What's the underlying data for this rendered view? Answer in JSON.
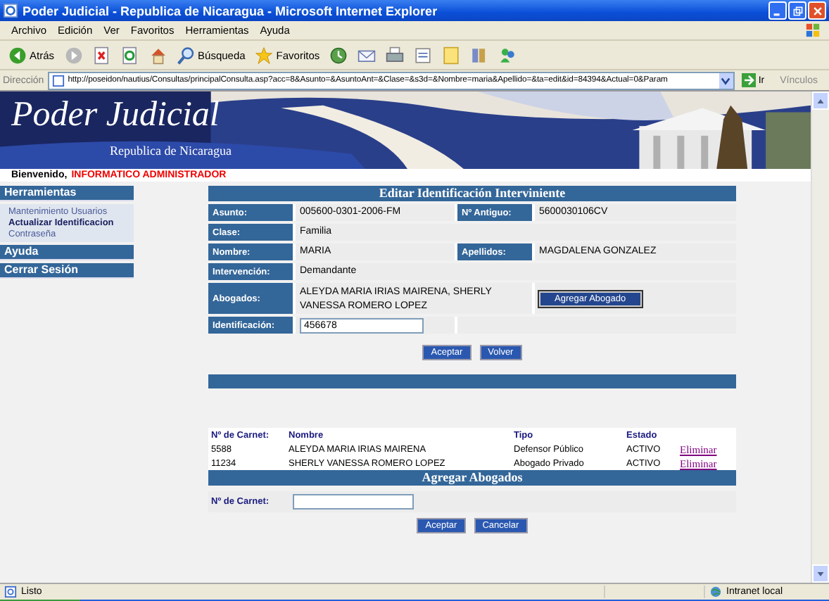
{
  "window": {
    "title": "Poder Judicial - Republica de Nicaragua - Microsoft Internet Explorer"
  },
  "menu": [
    "Archivo",
    "Edición",
    "Ver",
    "Favoritos",
    "Herramientas",
    "Ayuda"
  ],
  "toolbar": [
    {
      "kind": "back",
      "label": "Atrás"
    },
    {
      "kind": "forward"
    },
    {
      "kind": "stop"
    },
    {
      "kind": "refresh"
    },
    {
      "kind": "home"
    },
    {
      "kind": "search",
      "label": "Búsqueda"
    },
    {
      "kind": "favorites",
      "label": "Favoritos"
    },
    {
      "kind": "history"
    },
    {
      "kind": "mail"
    },
    {
      "kind": "print"
    },
    {
      "kind": "edit"
    },
    {
      "kind": "note"
    },
    {
      "kind": "research"
    },
    {
      "kind": "messenger"
    }
  ],
  "address": {
    "label": "Dirección",
    "value": "http://poseidon/nautius/Consultas/principalConsulta.asp?acc=8&Asunto=&AsuntoAnt=&Clase=&s3d=&Nombre=maria&Apellido=&ta=edit&id=84394&Actual=0&Param",
    "go": "Ir",
    "links": "Vínculos"
  },
  "banner": {
    "title": "Poder Judicial",
    "subtitle": "Republica de Nicaragua"
  },
  "welcome": {
    "label": "Bienvenido,",
    "user": "INFORMATICO ADMINISTRADOR"
  },
  "sidebar": [
    {
      "title": "Herramientas",
      "items": [
        {
          "label": "Mantenimiento Usuarios",
          "selected": false
        },
        {
          "label": "Actualizar Identificacion",
          "selected": true
        },
        {
          "label": "Contraseña",
          "selected": false
        }
      ]
    },
    {
      "title": "Ayuda"
    },
    {
      "title": "Cerrar Sesión"
    }
  ],
  "form": {
    "title": "Editar Identificación Interviniente",
    "rows": [
      {
        "label": "Asunto:",
        "value": "005600-0301-2006-FM",
        "label2": "Nº Antiguo:",
        "value2": "5600030106CV"
      },
      {
        "label": "Clase:",
        "value": "Familia"
      },
      {
        "label": "Nombre:",
        "value": "MARIA",
        "label2": "Apellidos:",
        "value2": "MAGDALENA GONZALEZ"
      },
      {
        "label": "Intervención:",
        "value": "Demandante"
      },
      {
        "label": "Abogados:",
        "value": "ALEYDA MARIA IRIAS MAIRENA, SHERLY VANESSA ROMERO LOPEZ",
        "button": "Agregar Abogado"
      },
      {
        "label": "Identificación:",
        "input": "456678"
      }
    ],
    "buttons": [
      "Aceptar",
      "Volver"
    ]
  },
  "table": {
    "columns": [
      "Nº de Carnet:",
      "Nombre",
      "Tipo",
      "Estado"
    ],
    "rows": [
      {
        "cells": [
          "5588",
          "ALEYDA MARIA IRIAS MAIRENA",
          "Defensor Público",
          "ACTIVO"
        ],
        "link": "Eliminar"
      },
      {
        "cells": [
          "11234",
          "SHERLY VANESSA ROMERO LOPEZ",
          "Abogado Privado",
          "ACTIVO"
        ],
        "link": "Eliminar"
      }
    ]
  },
  "add": {
    "title": "Agregar Abogados",
    "label": "Nº de Carnet:",
    "buttons": [
      "Aceptar",
      "Cancelar"
    ]
  },
  "status_bar": {
    "text": "Listo",
    "zone": "Intranet local"
  }
}
